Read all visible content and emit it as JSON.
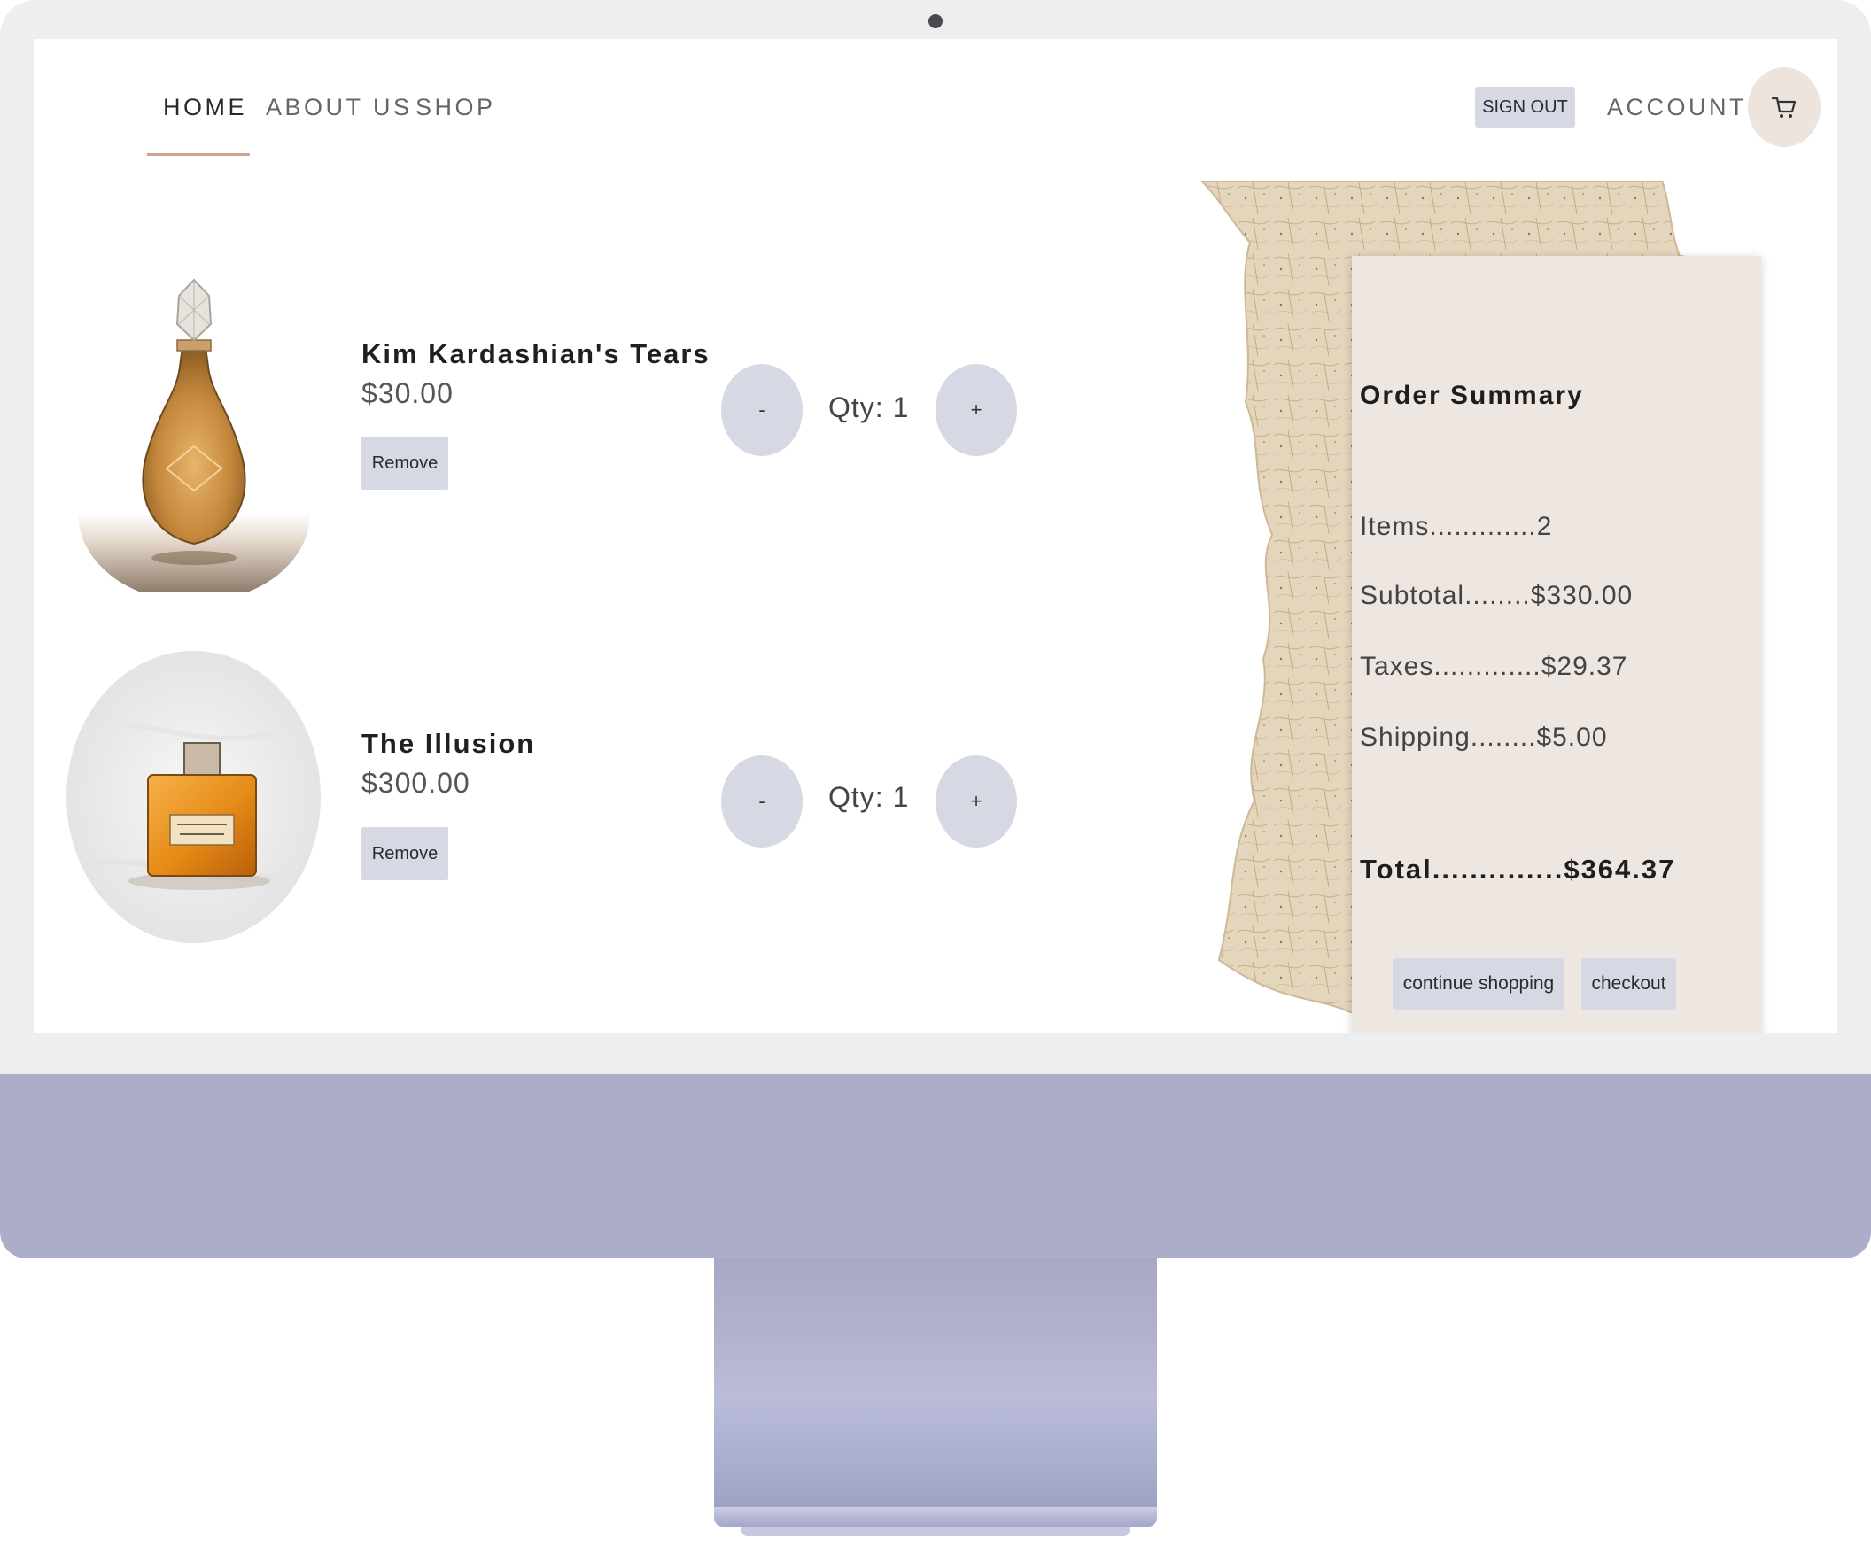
{
  "nav": {
    "home": "HOME",
    "about": "ABOUT US",
    "shop": "SHOP",
    "sign_out": "SIGN OUT",
    "account": "ACCOUNT",
    "cart_icon": "shopping-cart-icon",
    "active_underline_color": "#c8a691"
  },
  "cart": {
    "items": [
      {
        "name": "Kim Kardashian's Tears",
        "price": "$30.00",
        "remove": "Remove",
        "minus": "-",
        "plus": "+",
        "qty": "Qty: 1"
      },
      {
        "name": "The Illusion",
        "price": "$300.00",
        "remove": "Remove",
        "minus": "-",
        "plus": "+",
        "qty": "Qty: 1"
      }
    ]
  },
  "summary": {
    "title": "Order Summary",
    "items": "Items.............2",
    "subtotal": "Subtotal........$330.00",
    "taxes": "Taxes.............$29.37",
    "shipping": "Shipping........$5.00",
    "total": "Total..............$364.37",
    "continue_shopping": "continue shopping",
    "checkout": "checkout"
  },
  "colors": {
    "button_bg": "#d6d9e4",
    "summary_card_bg": "#ede6e1",
    "cart_circle_bg": "#ede4de",
    "monitor_frame": "#edeef0",
    "monitor_chin": "#abadc9"
  }
}
